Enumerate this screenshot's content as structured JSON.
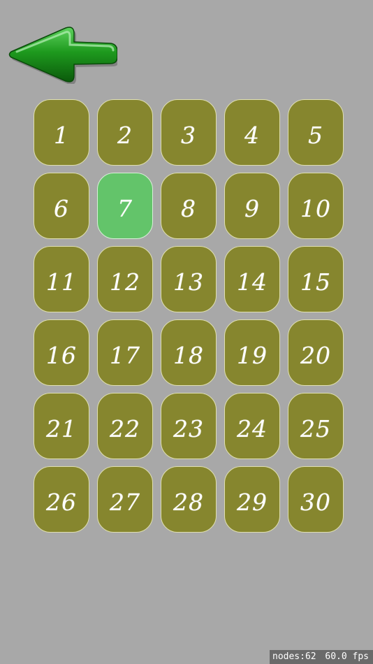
{
  "header": {
    "back_icon": "back-arrow-icon",
    "back_color": "#1f8a1f"
  },
  "levels": {
    "selected": "7",
    "tile_color": "#86862e",
    "selected_color": "#63c46a",
    "items": [
      {
        "label": "1"
      },
      {
        "label": "2"
      },
      {
        "label": "3"
      },
      {
        "label": "4"
      },
      {
        "label": "5"
      },
      {
        "label": "6"
      },
      {
        "label": "7"
      },
      {
        "label": "8"
      },
      {
        "label": "9"
      },
      {
        "label": "10"
      },
      {
        "label": "11"
      },
      {
        "label": "12"
      },
      {
        "label": "13"
      },
      {
        "label": "14"
      },
      {
        "label": "15"
      },
      {
        "label": "16"
      },
      {
        "label": "17"
      },
      {
        "label": "18"
      },
      {
        "label": "19"
      },
      {
        "label": "20"
      },
      {
        "label": "21"
      },
      {
        "label": "22"
      },
      {
        "label": "23"
      },
      {
        "label": "24"
      },
      {
        "label": "25"
      },
      {
        "label": "26"
      },
      {
        "label": "27"
      },
      {
        "label": "28"
      },
      {
        "label": "29"
      },
      {
        "label": "30"
      }
    ]
  },
  "stats": {
    "nodes": "nodes:62",
    "fps": "60.0 fps"
  }
}
